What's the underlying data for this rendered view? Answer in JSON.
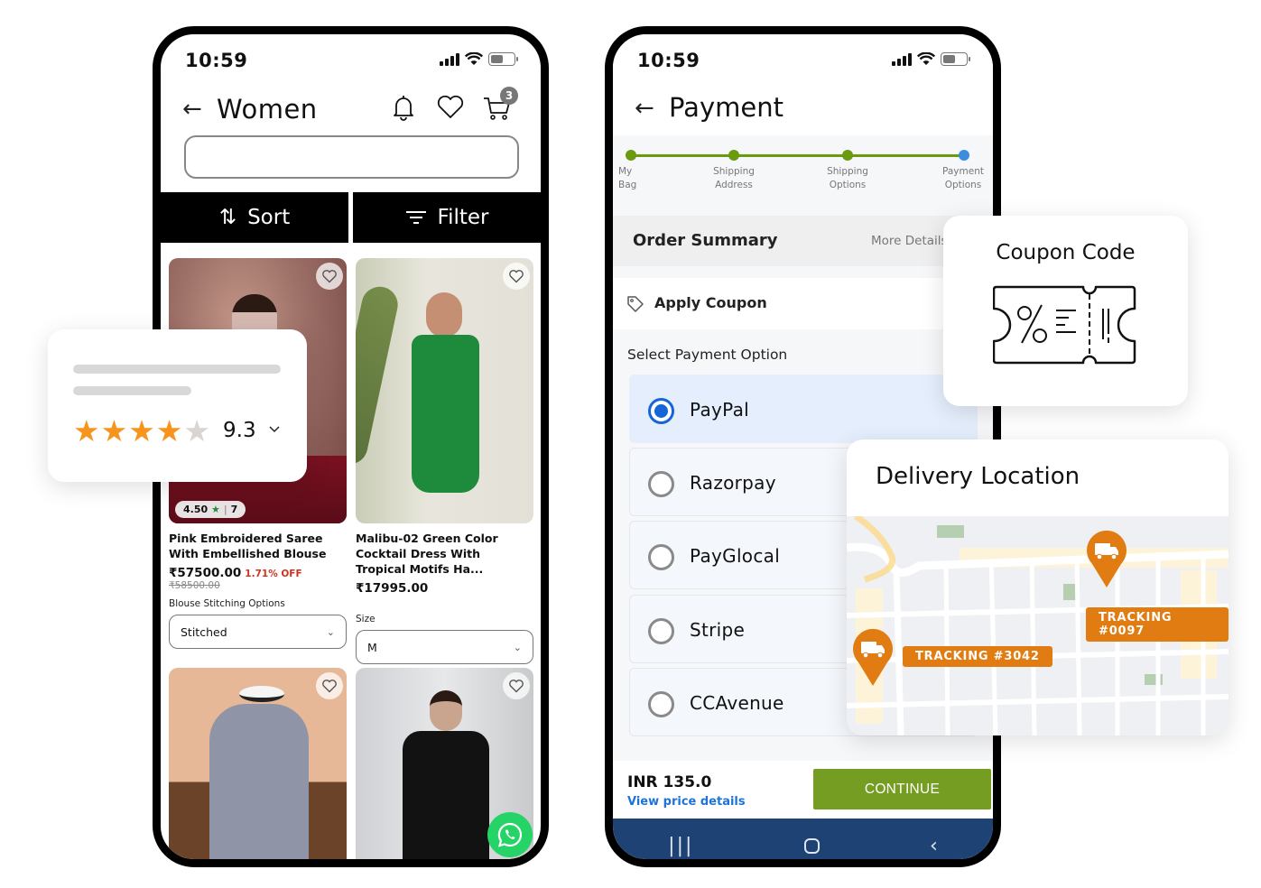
{
  "status": {
    "time": "10:59"
  },
  "catalog": {
    "title": "Women",
    "cart_count": "3",
    "search_placeholder": "",
    "sort_label": "Sort",
    "filter_label": "Filter",
    "products": [
      {
        "name": "Pink Embroidered Saree With Embellished Blouse",
        "price": "₹57500.00",
        "discount": "1.71% OFF",
        "original_price": "₹58500.00",
        "rating": "4.50",
        "rating_count": "7",
        "option_label": "Blouse Stitching Options",
        "option_value": "Stitched"
      },
      {
        "name": "Malibu-02 Green Color Cocktail Dress With Tropical Motifs Ha...",
        "price": "₹17995.00",
        "option_label": "Size",
        "option_value": "M"
      },
      {
        "name": ""
      },
      {
        "name": ""
      }
    ]
  },
  "rating_card": {
    "stars_filled": 4,
    "stars_total": 5,
    "score": "9.3"
  },
  "payment": {
    "title": "Payment",
    "steps": [
      {
        "line1": "My",
        "line2": "Bag",
        "status": "done"
      },
      {
        "line1": "Shipping",
        "line2": "Address",
        "status": "done"
      },
      {
        "line1": "Shipping",
        "line2": "Options",
        "status": "done"
      },
      {
        "line1": "Payment",
        "line2": "Options",
        "status": "current"
      }
    ],
    "order_summary": "Order Summary",
    "more_details": "More Details",
    "apply_coupon": "Apply Coupon",
    "select_option_label": "Select Payment Option",
    "options": [
      {
        "label": "PayPal",
        "selected": true
      },
      {
        "label": "Razorpay",
        "selected": false
      },
      {
        "label": "PayGlocal",
        "selected": false
      },
      {
        "label": "Stripe",
        "selected": false
      },
      {
        "label": "CCAvenue",
        "selected": false
      }
    ],
    "amount": "INR 135.0",
    "view_price_details": "View price details",
    "continue_label": "CONTINUE",
    "colors": {
      "accent_green": "#759d21",
      "selected_blue": "#1565d8",
      "nav_blue": "#1d4273"
    }
  },
  "coupon_card": {
    "title": "Coupon Code",
    "icon": "coupon-ticket-icon"
  },
  "delivery_card": {
    "title": "Delivery Location",
    "trackers": [
      {
        "label": "TRACKING #0097",
        "icon": "truck-icon"
      },
      {
        "label": "TRACKING #3042",
        "icon": "truck-icon"
      }
    ],
    "pin_color": "#e07c12"
  }
}
